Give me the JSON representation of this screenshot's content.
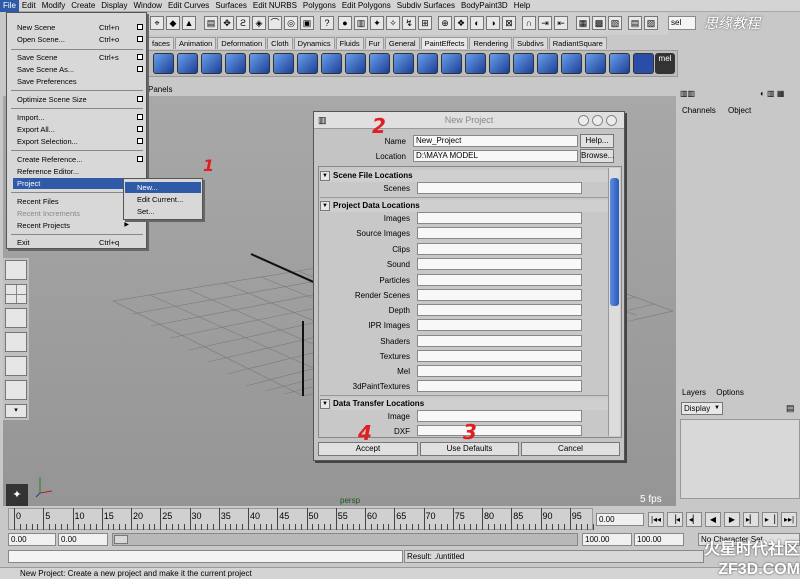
{
  "menubar": {
    "items": [
      "File",
      "Edit",
      "Modify",
      "Create",
      "Display",
      "Window",
      "Edit Curves",
      "Surfaces",
      "Edit NURBS",
      "Polygons",
      "Edit Polygons",
      "Subdiv Surfaces",
      "BodyPaint3D",
      "Help"
    ]
  },
  "status": {
    "selection_field": "sel"
  },
  "logo": "思缘教程",
  "shelf": {
    "tabs": [
      "faces",
      "Animation",
      "Deformation",
      "Cloth",
      "Dynamics",
      "Fluids",
      "Fur",
      "General",
      "PaintEffects",
      "Rendering",
      "Subdivs",
      "RadiantSquare"
    ],
    "mel_label": "mel"
  },
  "viewport": {
    "panel_menu": "Panels",
    "camera_label": "persp",
    "fps_label": "5 fps"
  },
  "file_menu": {
    "items": [
      {
        "label": "New Scene",
        "shortcut": "Ctrl+n"
      },
      {
        "label": "Open Scene...",
        "shortcut": "Ctrl+o"
      },
      {
        "label": "Save Scene",
        "shortcut": "Ctrl+s"
      },
      {
        "label": "Save Scene As...",
        "shortcut": ""
      },
      {
        "label": "Save Preferences",
        "shortcut": ""
      },
      {
        "label": "Optimize Scene Size",
        "shortcut": ""
      },
      {
        "label": "Import...",
        "shortcut": ""
      },
      {
        "label": "Export All...",
        "shortcut": ""
      },
      {
        "label": "Export Selection...",
        "shortcut": ""
      },
      {
        "label": "Create Reference...",
        "shortcut": ""
      },
      {
        "label": "Reference Editor...",
        "shortcut": ""
      },
      {
        "label": "Project",
        "shortcut": ""
      },
      {
        "label": "Recent Files",
        "shortcut": ""
      },
      {
        "label": "Recent Increments",
        "shortcut": ""
      },
      {
        "label": "Recent Projects",
        "shortcut": ""
      },
      {
        "label": "Exit",
        "shortcut": "Ctrl+q"
      }
    ]
  },
  "project_submenu": {
    "items": [
      "New...",
      "Edit Current...",
      "Set..."
    ]
  },
  "dialog": {
    "title": "New Project",
    "name_label": "Name",
    "name_value": "New_Project",
    "location_label": "Location",
    "location_value": "D:\\MAYA MODEL",
    "help_button": "Help...",
    "browse_button": "Browse...",
    "section_scene": "Scene File Locations",
    "scene_fields": [
      "Scenes"
    ],
    "section_data": "Project Data Locations",
    "data_fields": [
      "Images",
      "Source Images",
      "Clips",
      "Sound",
      "Particles",
      "Render Scenes",
      "Depth",
      "IPR Images",
      "Shaders",
      "Textures",
      "Mel",
      "3dPaintTextures"
    ],
    "section_transfer": "Data Transfer Locations",
    "transfer_fields": [
      "Image",
      "DXF"
    ],
    "accept_button": "Accept",
    "defaults_button": "Use Defaults",
    "cancel_button": "Cancel"
  },
  "annotations": [
    "1",
    "2",
    "3",
    "4"
  ],
  "channel_box": {
    "tabs": [
      "Channels",
      "Object"
    ]
  },
  "layer_editor": {
    "tabs": [
      "Layers",
      "Options"
    ],
    "display_value": "Display"
  },
  "time_slider": {
    "ticks": [
      "0",
      "5",
      "10",
      "15",
      "20",
      "25",
      "30",
      "35",
      "40",
      "45",
      "50",
      "55",
      "60",
      "65",
      "70",
      "75",
      "80",
      "85",
      "90",
      "95"
    ],
    "current_time": "0.00"
  },
  "range_slider": {
    "start_time": "0.00",
    "playback_start": "0.00",
    "playback_end": "100.00",
    "end_time": "100.00",
    "character_set": "No Character Set"
  },
  "command_line": {
    "result": "Result: ./untitled"
  },
  "help_line": "New Project: Create a new project and make it the current project",
  "watermark": "火星时代社区 ZF3D.COM"
}
